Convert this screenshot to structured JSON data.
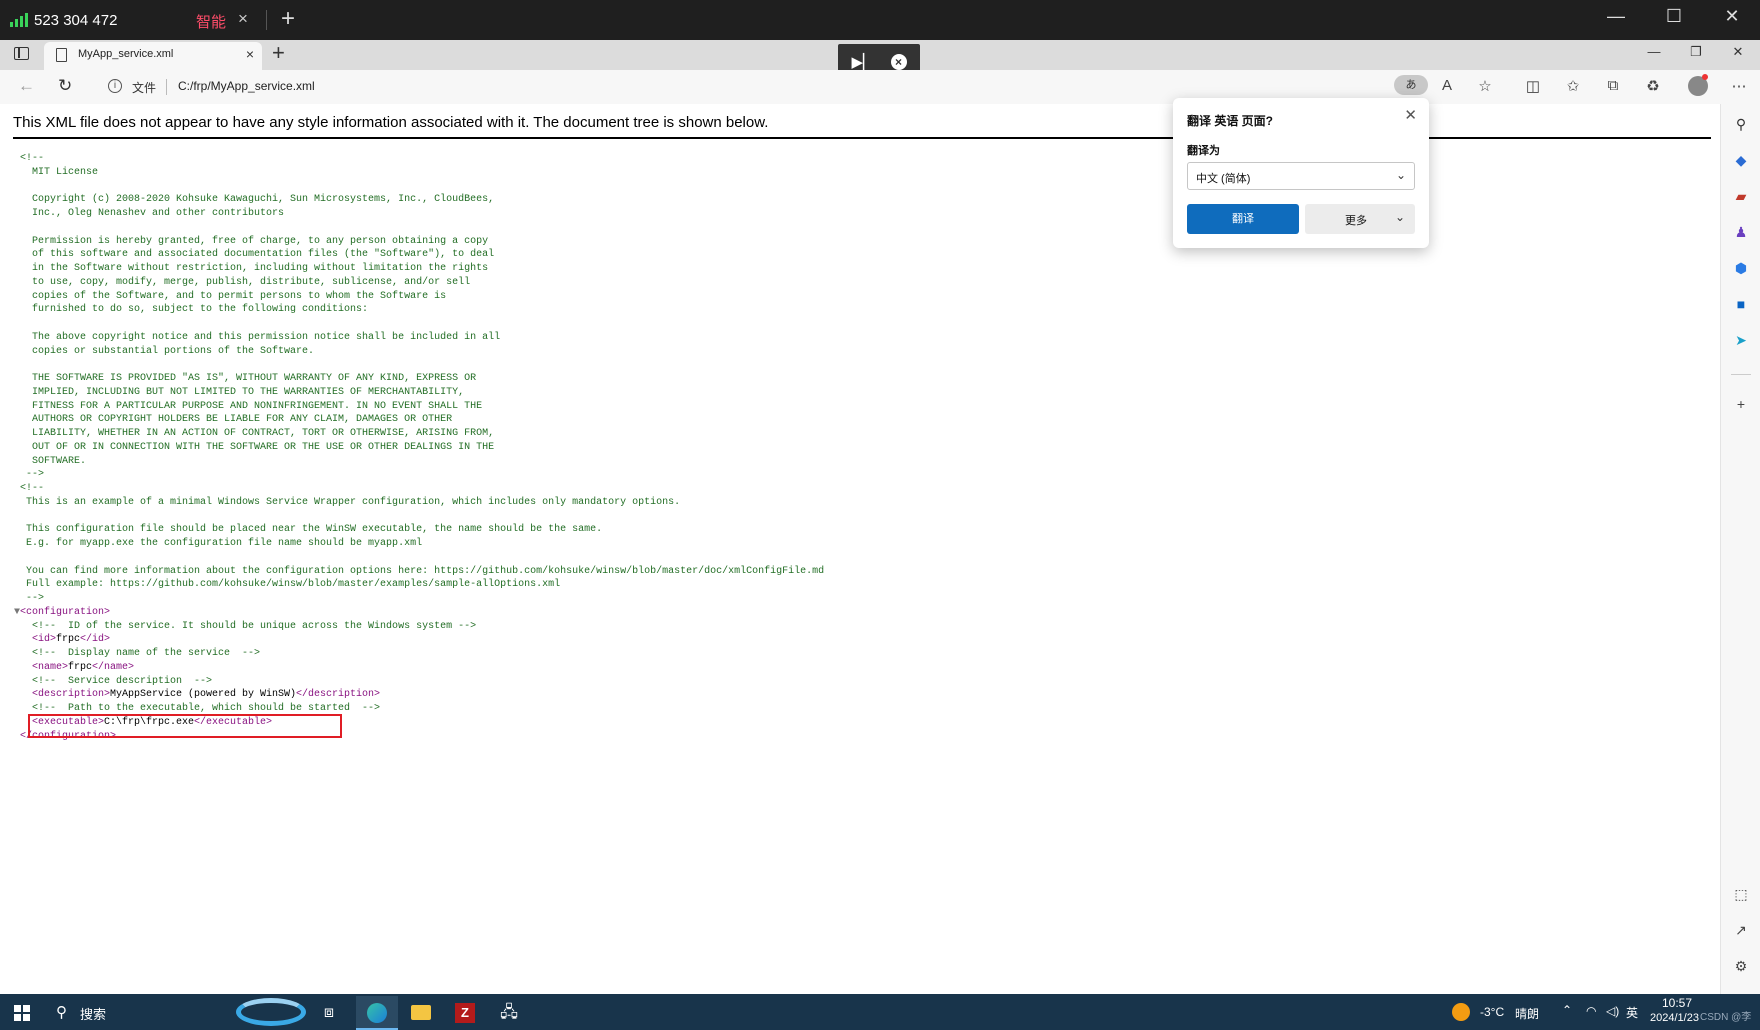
{
  "remote_bar": {
    "number": "523 304 472",
    "tab_label": "智能",
    "close_glyph": "×",
    "plus_glyph": "+",
    "minimize_glyph": "—",
    "maximize_glyph": "☐",
    "close_window_glyph": "✕"
  },
  "browser": {
    "tab_title": "MyApp_service.xml",
    "tab_close": "×",
    "new_tab": "+",
    "address": {
      "scheme_label": "文件",
      "url": "C:/frp/MyApp_service.xml",
      "translate_icon_text": "あ"
    }
  },
  "page": {
    "notice": "This XML file does not appear to have any style information associated with it. The document tree is shown below."
  },
  "xml_lines": [
    {
      "t": "cmt",
      "v": " <!--"
    },
    {
      "t": "cmt",
      "v": "   MIT License"
    },
    {
      "t": "cmt",
      "v": ""
    },
    {
      "t": "cmt",
      "v": "   Copyright (c) 2008-2020 Kohsuke Kawaguchi, Sun Microsystems, Inc., CloudBees,"
    },
    {
      "t": "cmt",
      "v": "   Inc., Oleg Nenashev and other contributors"
    },
    {
      "t": "cmt",
      "v": ""
    },
    {
      "t": "cmt",
      "v": "   Permission is hereby granted, free of charge, to any person obtaining a copy"
    },
    {
      "t": "cmt",
      "v": "   of this software and associated documentation files (the \"Software\"), to deal"
    },
    {
      "t": "cmt",
      "v": "   in the Software without restriction, including without limitation the rights"
    },
    {
      "t": "cmt",
      "v": "   to use, copy, modify, merge, publish, distribute, sublicense, and/or sell"
    },
    {
      "t": "cmt",
      "v": "   copies of the Software, and to permit persons to whom the Software is"
    },
    {
      "t": "cmt",
      "v": "   furnished to do so, subject to the following conditions:"
    },
    {
      "t": "cmt",
      "v": ""
    },
    {
      "t": "cmt",
      "v": "   The above copyright notice and this permission notice shall be included in all"
    },
    {
      "t": "cmt",
      "v": "   copies or substantial portions of the Software."
    },
    {
      "t": "cmt",
      "v": ""
    },
    {
      "t": "cmt",
      "v": "   THE SOFTWARE IS PROVIDED \"AS IS\", WITHOUT WARRANTY OF ANY KIND, EXPRESS OR"
    },
    {
      "t": "cmt",
      "v": "   IMPLIED, INCLUDING BUT NOT LIMITED TO THE WARRANTIES OF MERCHANTABILITY,"
    },
    {
      "t": "cmt",
      "v": "   FITNESS FOR A PARTICULAR PURPOSE AND NONINFRINGEMENT. IN NO EVENT SHALL THE"
    },
    {
      "t": "cmt",
      "v": "   AUTHORS OR COPYRIGHT HOLDERS BE LIABLE FOR ANY CLAIM, DAMAGES OR OTHER"
    },
    {
      "t": "cmt",
      "v": "   LIABILITY, WHETHER IN AN ACTION OF CONTRACT, TORT OR OTHERWISE, ARISING FROM,"
    },
    {
      "t": "cmt",
      "v": "   OUT OF OR IN CONNECTION WITH THE SOFTWARE OR THE USE OR OTHER DEALINGS IN THE"
    },
    {
      "t": "cmt",
      "v": "   SOFTWARE."
    },
    {
      "t": "cmt",
      "v": "  -->"
    },
    {
      "t": "cmt",
      "v": " <!--"
    },
    {
      "t": "cmt",
      "v": "  This is an example of a minimal Windows Service Wrapper configuration, which includes only mandatory options."
    },
    {
      "t": "cmt",
      "v": ""
    },
    {
      "t": "cmt",
      "v": "  This configuration file should be placed near the WinSW executable, the name should be the same."
    },
    {
      "t": "cmt",
      "v": "  E.g. for myapp.exe the configuration file name should be myapp.xml"
    },
    {
      "t": "cmt",
      "v": ""
    },
    {
      "t": "cmt",
      "v": "  You can find more information about the configuration options here: https://github.com/kohsuke/winsw/blob/master/doc/xmlConfigFile.md"
    },
    {
      "t": "cmt",
      "v": "  Full example: https://github.com/kohsuke/winsw/blob/master/examples/sample-allOptions.xml"
    },
    {
      "t": "cmt",
      "v": "  -->"
    },
    {
      "t": "open",
      "toggle": "▼",
      "v": "<configuration>"
    },
    {
      "t": "cmt",
      "v": "   <!--  ID of the service. It should be unique across the Windows system -->"
    },
    {
      "t": "el",
      "open": "   <id>",
      "text": "frpc",
      "close": "</id>"
    },
    {
      "t": "cmt",
      "v": "   <!--  Display name of the service  -->"
    },
    {
      "t": "el",
      "open": "   <name>",
      "text": "frpc",
      "close": "</name>"
    },
    {
      "t": "cmt",
      "v": "   <!--  Service description  -->"
    },
    {
      "t": "el",
      "open": "   <description>",
      "text": "MyAppService (powered by WinSW)",
      "close": "</description>"
    },
    {
      "t": "cmt",
      "v": "   <!--  Path to the executable, which should be started  -->"
    },
    {
      "t": "el",
      "open": "   <executable>",
      "text": "C:\\frp\\frpc.exe",
      "close": "</executable>"
    },
    {
      "t": "tag",
      "v": " </configuration>"
    }
  ],
  "translate_popup": {
    "title": "翻译 英语 页面?",
    "close_glyph": "✕",
    "label": "翻译为",
    "selected_language": "中文 (简体)",
    "translate_button": "翻译",
    "more_button": "更多"
  },
  "taskbar": {
    "search_label": "搜索",
    "temperature": "-3°C",
    "weather": "晴朗",
    "ime": "英",
    "time": "10:57",
    "date": "2024/1/23",
    "watermark": "CSDN @李"
  },
  "colors": {
    "comment": "#236e25",
    "tag": "#881280",
    "highlight_box": "#e01d25",
    "translate_button": "#0f6cbd"
  }
}
